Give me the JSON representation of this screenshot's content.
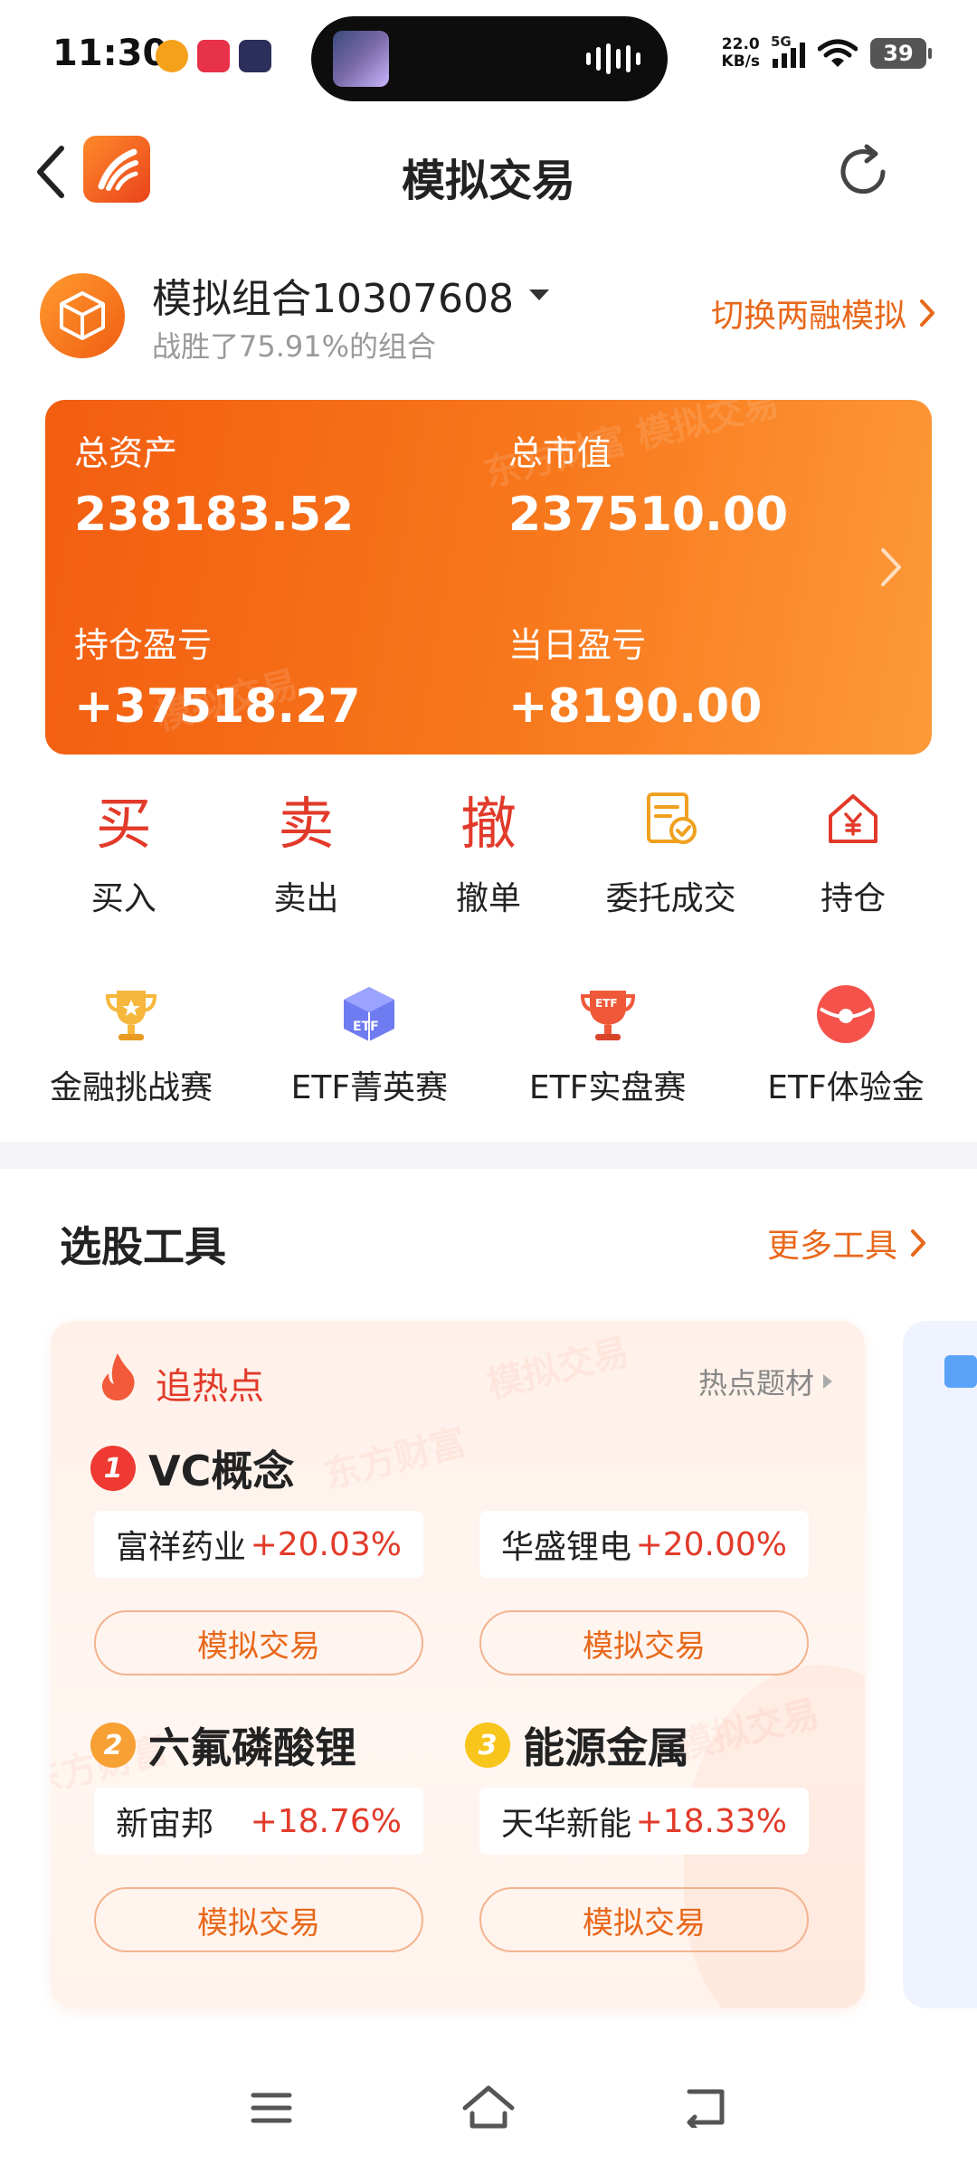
{
  "status_bar": {
    "time": "11:30",
    "speed_value": "22.0",
    "speed_unit": "KB/s",
    "network": "5G",
    "battery": "39"
  },
  "header": {
    "title": "模拟交易"
  },
  "account": {
    "name": "模拟组合10307608",
    "subtitle": "战胜了75.91%的组合",
    "switch_label": "切换两融模拟"
  },
  "assets": {
    "total_assets_label": "总资产",
    "total_assets_value": "238183.52",
    "market_value_label": "总市值",
    "market_value_value": "237510.00",
    "position_pl_label": "持仓盈亏",
    "position_pl_value": "+37518.27",
    "daily_pl_label": "当日盈亏",
    "daily_pl_value": "+8190.00"
  },
  "actions": [
    {
      "glyph": "买",
      "label": "买入"
    },
    {
      "glyph": "卖",
      "label": "卖出"
    },
    {
      "glyph": "撤",
      "label": "撤单"
    },
    {
      "label": "委托成交"
    },
    {
      "label": "持仓"
    }
  ],
  "events": [
    {
      "label": "金融挑战赛"
    },
    {
      "label": "ETF菁英赛"
    },
    {
      "label": "ETF实盘赛",
      "badge": "ETF"
    },
    {
      "label": "ETF体验金"
    }
  ],
  "tools": {
    "title": "选股工具",
    "more_label": "更多工具"
  },
  "hot": {
    "title": "追热点",
    "topic_link": "热点题材",
    "trade_label": "模拟交易",
    "categories": [
      {
        "rank": "1",
        "name": "VC概念",
        "stocks": [
          {
            "name": "富祥药业",
            "pct": "+20.03%"
          },
          {
            "name": "华盛锂电",
            "pct": "+20.00%"
          }
        ]
      },
      {
        "rank": "2",
        "name": "六氟磷酸锂",
        "stocks": [
          {
            "name": "新宙邦",
            "pct": "+18.76%"
          }
        ]
      },
      {
        "rank": "3",
        "name": "能源金属",
        "stocks": [
          {
            "name": "天华新能",
            "pct": "+18.33%"
          }
        ]
      }
    ]
  },
  "watermark": {
    "brand": "东方财富",
    "tag": "模拟交易"
  },
  "colors": {
    "accent_orange": "#e8681b",
    "rise_red": "#e23a2a",
    "card_gradient_start": "#f25d10",
    "card_gradient_end": "#fd9a3a"
  }
}
